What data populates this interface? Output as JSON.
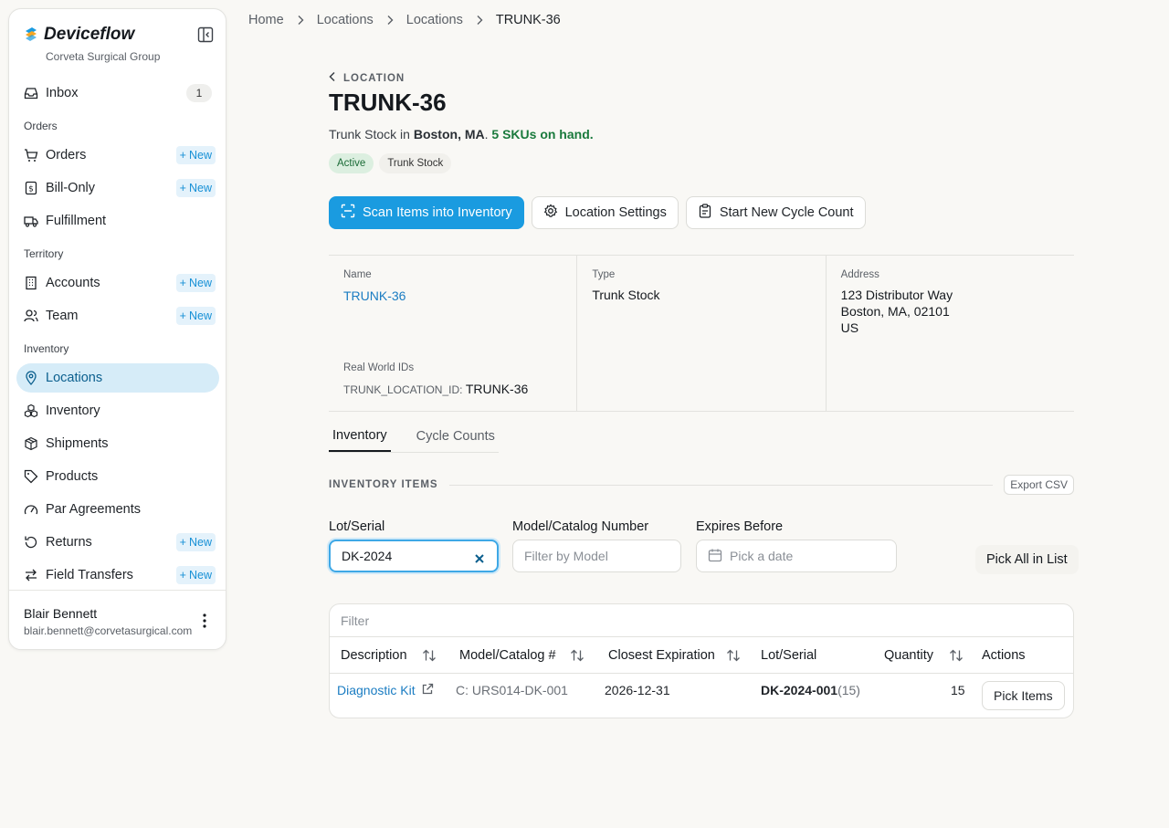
{
  "app": {
    "name": "Deviceflow",
    "org": "Corveta Surgical Group"
  },
  "sidebar": {
    "inbox": {
      "label": "Inbox",
      "count": "1"
    },
    "sections": {
      "orders": "Orders",
      "territory": "Territory",
      "inventory": "Inventory"
    },
    "new_label": "New",
    "items": {
      "orders": "Orders",
      "bill_only": "Bill-Only",
      "fulfillment": "Fulfillment",
      "accounts": "Accounts",
      "team": "Team",
      "locations": "Locations",
      "inventory": "Inventory",
      "shipments": "Shipments",
      "products": "Products",
      "par_agreements": "Par Agreements",
      "returns": "Returns",
      "field_transfers": "Field Transfers"
    },
    "user": {
      "name": "Blair Bennett",
      "email": "blair.bennett@corvetasurgical.com"
    }
  },
  "breadcrumb": [
    "Home",
    "Locations",
    "Locations",
    "TRUNK-36"
  ],
  "header": {
    "back_label": "LOCATION",
    "title": "TRUNK-36",
    "subtitle_prefix": "Trunk Stock in ",
    "subtitle_city": "Boston, MA",
    "subtitle_dot": ". ",
    "subtitle_skus": "5 SKUs on hand.",
    "badges": [
      "Active",
      "Trunk Stock"
    ]
  },
  "actions": {
    "scan": "Scan Items into Inventory",
    "settings": "Location Settings",
    "cycle": "Start New Cycle Count"
  },
  "info": {
    "name_label": "Name",
    "name_value": "TRUNK-36",
    "type_label": "Type",
    "type_value": "Trunk Stock",
    "address_label": "Address",
    "address_lines": [
      "123 Distributor Way",
      "Boston, MA, 02101",
      "US"
    ],
    "rw_label": "Real World IDs",
    "rw_key": "TRUNK_LOCATION_ID: ",
    "rw_value": "TRUNK-36"
  },
  "tabs": [
    "Inventory",
    "Cycle Counts"
  ],
  "inventory_section": {
    "title": "INVENTORY ITEMS",
    "export": "Export CSV"
  },
  "filters": {
    "lot_label": "Lot/Serial",
    "lot_value": "DK-2024",
    "model_label": "Model/Catalog Number",
    "model_placeholder": "Filter by Model",
    "expires_label": "Expires Before",
    "expires_placeholder": "Pick a date",
    "pick_all": "Pick All in List"
  },
  "table": {
    "filter_placeholder": "Filter",
    "columns": [
      "Description",
      "Model/Catalog #",
      "Closest Expiration",
      "Lot/Serial",
      "Quantity",
      "Actions"
    ],
    "rows": [
      {
        "description": "Diagnostic Kit",
        "model": "C: URS014-DK-001",
        "expiration": "2026-12-31",
        "lot": "DK-2024-001",
        "lot_count": "(15)",
        "quantity": "15",
        "action": "Pick Items"
      }
    ]
  }
}
